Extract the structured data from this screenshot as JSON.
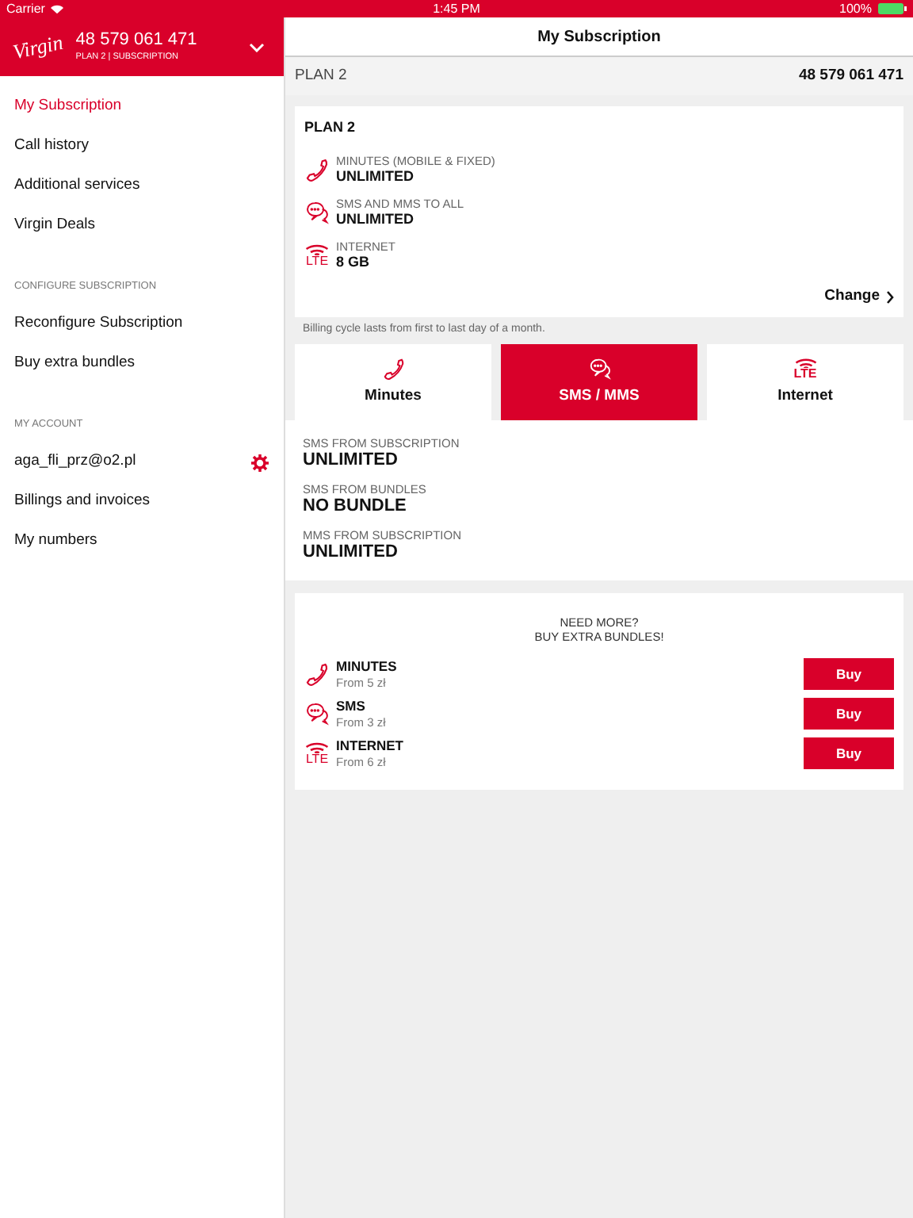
{
  "status_bar": {
    "carrier": "Carrier",
    "time": "1:45 PM",
    "battery": "100%"
  },
  "sidebar": {
    "logo": "Virgin",
    "number": "48 579 061 471",
    "subtitle": "PLAN 2 | SUBSCRIPTION",
    "sections": [
      {
        "items": [
          {
            "label": "My Subscription",
            "selected": true
          },
          {
            "label": "Call history",
            "selected": false
          },
          {
            "label": "Additional services",
            "selected": false
          },
          {
            "label": "Virgin Deals",
            "selected": false
          }
        ]
      },
      {
        "heading": "CONFIGURE SUBSCRIPTION",
        "items": [
          {
            "label": "Reconfigure Subscription",
            "selected": false
          },
          {
            "label": "Buy extra bundles",
            "selected": false
          }
        ]
      },
      {
        "heading": "MY ACCOUNT",
        "items": [
          {
            "label": "aga_fli_prz@o2.pl",
            "selected": false,
            "settings": true
          },
          {
            "label": "Billings and invoices",
            "selected": false
          },
          {
            "label": "My numbers",
            "selected": false
          }
        ]
      }
    ]
  },
  "main": {
    "title": "My Subscription",
    "plan_bar": {
      "plan": "PLAN 2",
      "number": "48 579 061 471"
    },
    "plan_card": {
      "title": "PLAN 2",
      "features": [
        {
          "kind": "phone",
          "label": "MINUTES (MOBILE & FIXED)",
          "value": "UNLIMITED"
        },
        {
          "kind": "chat",
          "label": "SMS AND MMS TO ALL",
          "value": "UNLIMITED"
        },
        {
          "kind": "lte",
          "icon_text": "LTE",
          "label": "INTERNET",
          "value": "8 GB"
        }
      ],
      "change_link": "Change"
    },
    "billing_note": "Billing cycle lasts from first to last day of a month.",
    "tabs": [
      {
        "kind": "phone",
        "label": "Minutes",
        "selected": false
      },
      {
        "kind": "chat",
        "label": "SMS / MMS",
        "selected": true
      },
      {
        "kind": "lte",
        "icon_text": "LTE",
        "label": "Internet",
        "selected": false
      }
    ],
    "details": [
      {
        "label": "SMS FROM SUBSCRIPTION",
        "value": "UNLIMITED"
      },
      {
        "label": "SMS FROM BUNDLES",
        "value": "NO BUNDLE"
      },
      {
        "label": "MMS FROM SUBSCRIPTION",
        "value": "UNLIMITED"
      }
    ],
    "extras": {
      "heading": [
        "NEED MORE?",
        "BUY EXTRA BUNDLES!"
      ],
      "items": [
        {
          "kind": "phone",
          "name": "MINUTES",
          "price": "From 5 zł",
          "button": "Buy"
        },
        {
          "kind": "chat",
          "name": "SMS",
          "price": "From 3 zł",
          "button": "Buy"
        },
        {
          "kind": "lte",
          "icon_text": "LTE",
          "name": "INTERNET",
          "price": "From 6 zł",
          "button": "Buy"
        }
      ]
    }
  }
}
